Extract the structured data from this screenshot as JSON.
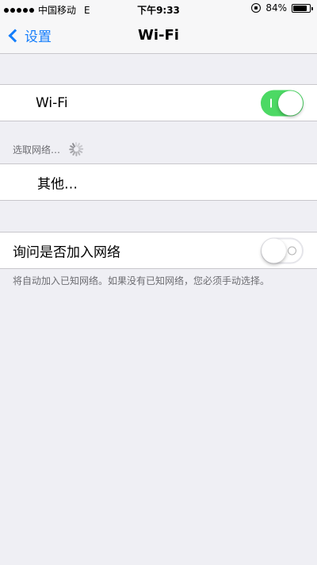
{
  "status_bar": {
    "carrier": "中国移动",
    "network": "E",
    "time": "下午9:33",
    "battery_percent": "84%",
    "battery_level": 0.84
  },
  "nav": {
    "back_label": "设置",
    "title": "Wi-Fi"
  },
  "wifi_toggle": {
    "label": "Wi-Fi",
    "on": true
  },
  "networks": {
    "header": "选取网络…",
    "other_label": "其他…"
  },
  "ask_to_join": {
    "label": "询问是否加入网络",
    "on": false,
    "footer": "将自动加入已知网络。如果没有已知网络，您必须手动选择。"
  },
  "colors": {
    "accent": "#157efb",
    "switch_on": "#4cd964",
    "background": "#efeff4"
  }
}
